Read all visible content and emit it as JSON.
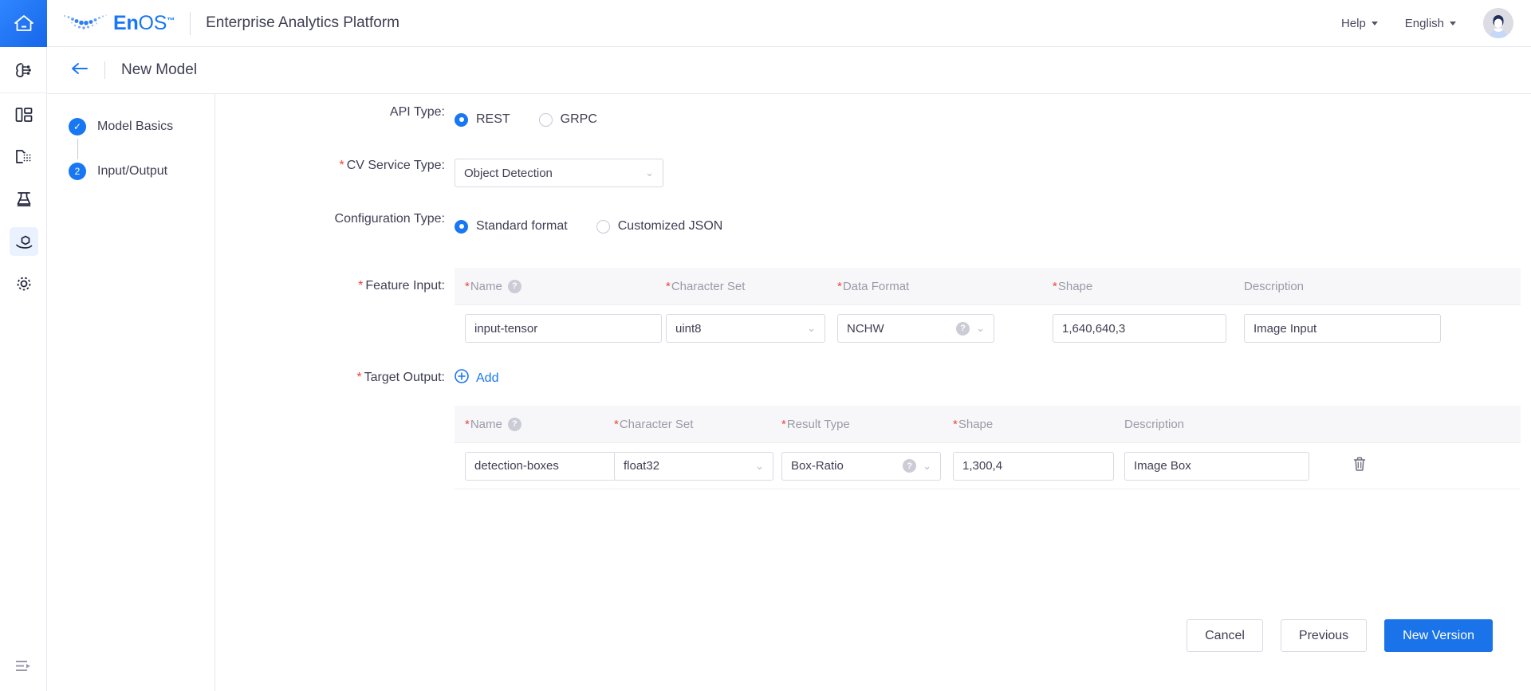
{
  "topbar": {
    "home_icon": "home-icon",
    "brand_en": "En",
    "brand_os": "OS",
    "brand_tm": "™",
    "app_title": "Enterprise Analytics Platform",
    "help_label": "Help",
    "language_label": "English"
  },
  "rail": {
    "items": [
      {
        "icon": "ai-model-icon",
        "label": "AI Model"
      },
      {
        "icon": "dashboard-icon",
        "label": "Dashboard"
      },
      {
        "icon": "data-folder-icon",
        "label": "Data Assets"
      },
      {
        "icon": "lab-flask-icon",
        "label": "Experiments"
      },
      {
        "icon": "model-serving-icon",
        "label": "Model Serving"
      },
      {
        "icon": "settings-gear-icon",
        "label": "Settings"
      }
    ],
    "collapse_icon": "collapse-sidebar-icon"
  },
  "page_header": {
    "back_icon": "back-arrow-icon",
    "title": "New Model"
  },
  "steps": [
    {
      "marker": "✓",
      "label": "Model Basics",
      "state": "done"
    },
    {
      "marker": "2",
      "label": "Input/Output",
      "state": "active"
    }
  ],
  "form": {
    "api_type": {
      "label": "API Type:",
      "options": [
        "REST",
        "GRPC"
      ],
      "selected": "REST"
    },
    "cv_service_type": {
      "label": "CV Service Type:",
      "required": "*",
      "value": "Object Detection",
      "chevron": "chevron-down-icon"
    },
    "configuration_type": {
      "label": "Configuration Type:",
      "options": [
        "Standard format",
        "Customized JSON"
      ],
      "selected": "Standard format"
    },
    "feature_input": {
      "label": "Feature Input:",
      "required": "*",
      "columns": [
        {
          "label": "Name",
          "required": true,
          "help": true
        },
        {
          "label": "Character Set",
          "required": true,
          "help": false
        },
        {
          "label": "Data Format",
          "required": true,
          "help": false
        },
        {
          "label": "Shape",
          "required": true,
          "help": false
        },
        {
          "label": "Description",
          "required": false,
          "help": false
        }
      ],
      "rows": [
        {
          "name": "input-tensor",
          "character_set": "uint8",
          "data_format": "NCHW",
          "shape": "1,640,640,3",
          "description": "Image Input"
        }
      ]
    },
    "target_output": {
      "label": "Target Output:",
      "required": "*",
      "add_label": "Add",
      "add_icon": "plus-circle-icon",
      "columns": [
        {
          "label": "Name",
          "required": true,
          "help": true
        },
        {
          "label": "Character Set",
          "required": true,
          "help": false
        },
        {
          "label": "Result Type",
          "required": true,
          "help": false
        },
        {
          "label": "Shape",
          "required": true,
          "help": false
        },
        {
          "label": "Description",
          "required": false,
          "help": false
        }
      ],
      "rows": [
        {
          "name": "detection-boxes",
          "character_set": "float32",
          "result_type": "Box-Ratio",
          "shape": "1,300,4",
          "description": "Image Box",
          "delete_icon": "trash-icon"
        }
      ]
    }
  },
  "footer": {
    "cancel_label": "Cancel",
    "previous_label": "Previous",
    "submit_label": "New Version"
  },
  "colors": {
    "accent": "#1877f2",
    "primary_button": "#1a73e8",
    "required_star": "#f04134",
    "header_bg": "#f7f7fa"
  }
}
